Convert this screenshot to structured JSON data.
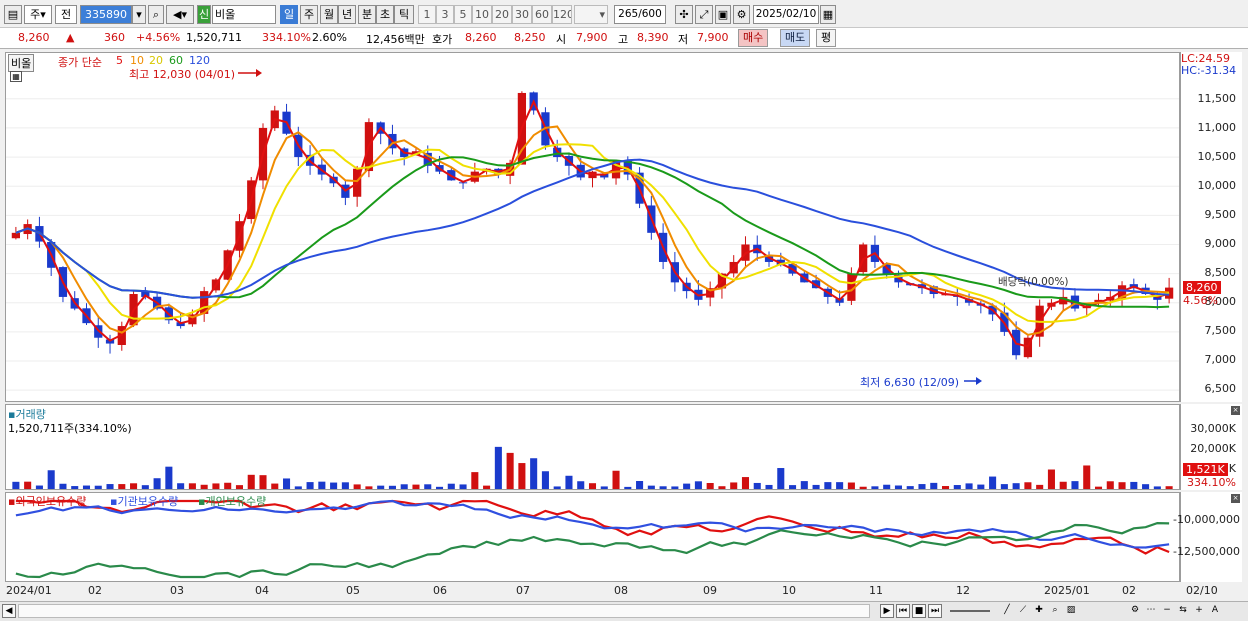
{
  "toolbar": {
    "market": "주",
    "period_sel": "전",
    "code": "335890",
    "name": "비올",
    "name_tag": "신",
    "units": [
      "일",
      "주",
      "월",
      "년",
      "분",
      "초",
      "틱"
    ],
    "numbers": [
      "1",
      "3",
      "5",
      "10",
      "20",
      "30",
      "60",
      "120"
    ],
    "count": "265",
    "count_total": "/600",
    "date": "2025/02/10"
  },
  "quote": {
    "price": "8,260",
    "change": "360",
    "change_pct": "+4.56%",
    "volume": "1,520,711",
    "vol_ratio": "334.10%",
    "turnover": "2.60%",
    "amount": "12,456백만",
    "hoga_label": "호가",
    "ask": "8,260",
    "bid": "8,250",
    "open_label": "시",
    "open": "7,900",
    "high_label": "고",
    "high": "8,390",
    "low_label": "저",
    "low": "7,900",
    "buy_button": "매수",
    "sell_button": "매도",
    "avg_button": "평"
  },
  "price_pane": {
    "tag": "비올",
    "ma_title": "종가 단순",
    "ma_periods": [
      "5",
      "10",
      "20",
      "60",
      "120"
    ],
    "high_annot": "최고 12,030 (04/01)",
    "low_annot": "최저 6,630 (12/09)",
    "lc": "LC:24.59",
    "hc": "HC:-31.34",
    "dividend_annot": "배당락(0.00%)",
    "cur_price": "8,260",
    "cur_pct": "4.56%",
    "yticks": [
      "11,500",
      "11,000",
      "10,500",
      "10,000",
      "9,500",
      "9,000",
      "8,500",
      "8,000",
      "7,500",
      "7,000",
      "6,500"
    ]
  },
  "volume_pane": {
    "title": "거래량",
    "info": "1,520,711주(334.10%)",
    "yticks": [
      "30,000K",
      "20,000K",
      "10,000K"
    ],
    "cur": "1,521K",
    "cur_pct": "334.10%"
  },
  "holding_pane": {
    "legend": [
      "외국인보유수량",
      "기관보유수량",
      "개인보유수량"
    ],
    "yticks": [
      "-10,000,000",
      "-12,500,000"
    ]
  },
  "xaxis": [
    "2024/01",
    "02",
    "03",
    "04",
    "05",
    "06",
    "07",
    "08",
    "09",
    "10",
    "11",
    "12",
    "2025/01",
    "02",
    "02/10"
  ],
  "colors": {
    "ma5": "#e01010",
    "ma10": "#f08c00",
    "ma20": "#f0e000",
    "ma60": "#1a9a1a",
    "ma120": "#2a4fdc",
    "foreign": "#e01010",
    "inst": "#3050e0",
    "indiv": "#2a8a4a",
    "up": "#d01010",
    "down": "#1a3acc"
  },
  "chart_data": {
    "type": "candlestick",
    "ylim": [
      6400,
      12200
    ],
    "close_series": [
      9200,
      9350,
      9050,
      8600,
      8100,
      7900,
      7650,
      7400,
      7300,
      7600,
      8150,
      8100,
      7900,
      7700,
      7600,
      7800,
      8200,
      8400,
      8900,
      9400,
      10100,
      11000,
      11300,
      10900,
      10500,
      10350,
      10200,
      10050,
      9800,
      10300,
      11100,
      10900,
      10650,
      10500,
      10600,
      10350,
      10250,
      10100,
      10050,
      10250,
      10300,
      10200,
      10400,
      11600,
      11300,
      10700,
      10500,
      10350,
      10150,
      10250,
      10150,
      10450,
      10200,
      9700,
      9200,
      8700,
      8350,
      8200,
      8050,
      8250,
      8500,
      8700,
      9000,
      8850,
      8700,
      8650,
      8500,
      8350,
      8250,
      8100,
      8000,
      8500,
      9000,
      8700,
      8500,
      8350,
      8300,
      8250,
      8150,
      8150,
      8100,
      8000,
      7950,
      7800,
      7500,
      7100,
      7400,
      7950,
      8000,
      8100,
      7900,
      7950,
      8050,
      8100,
      8300,
      8250,
      8150,
      8050,
      8260
    ]
  }
}
